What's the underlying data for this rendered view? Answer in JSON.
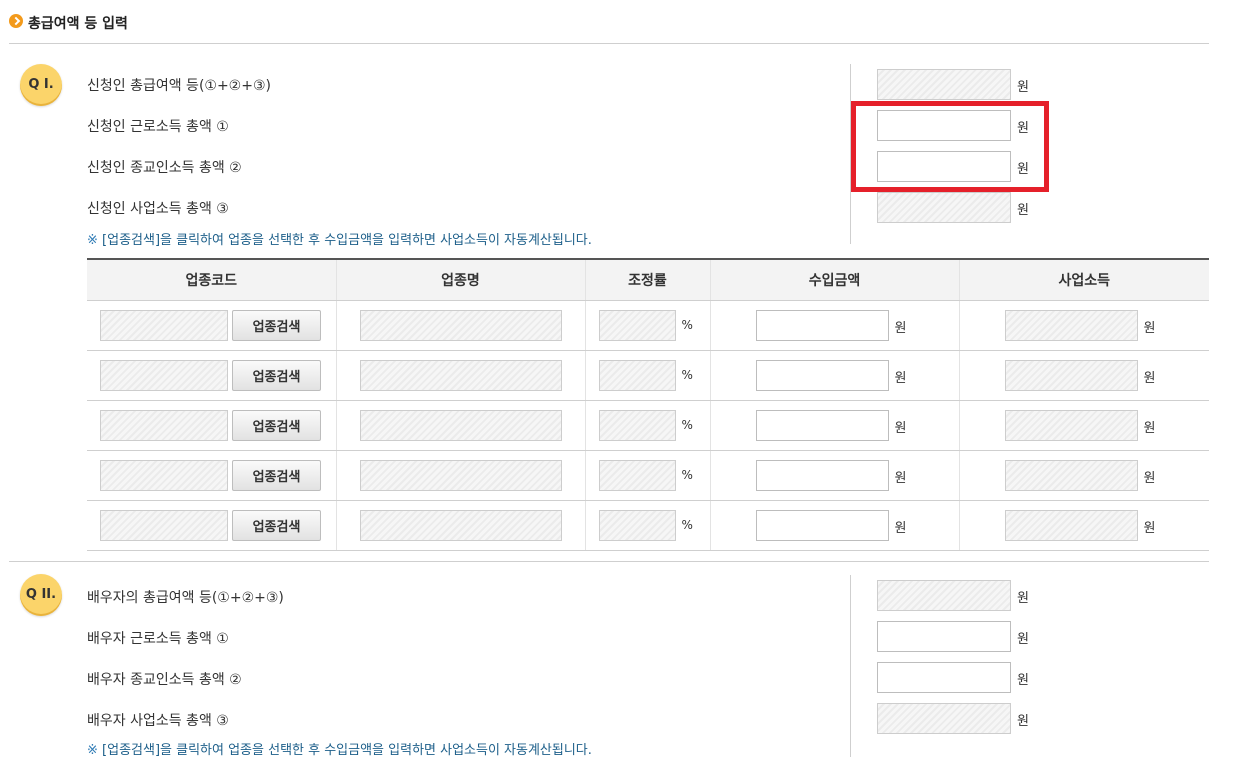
{
  "page": {
    "title": "총급여액 등 입력"
  },
  "q1": {
    "badge": "Q I.",
    "rows": [
      {
        "label": "신청인 총급여액 등(①+②+③)",
        "unit": "원",
        "readonly": true
      },
      {
        "label": "신청인 근로소득 총액 ①",
        "unit": "원",
        "readonly": false
      },
      {
        "label": "신청인 종교인소득 총액 ②",
        "unit": "원",
        "readonly": false
      },
      {
        "label": "신청인 사업소득 총액 ③",
        "unit": "원",
        "readonly": true
      }
    ],
    "note_mark": "※",
    "note": "[업종검색]을 클릭하여 업종을 선택한 후 수입금액을 입력하면 사업소득이 자동계산됩니다."
  },
  "table": {
    "headers": [
      "업종코드",
      "업종명",
      "조정률",
      "수입금액",
      "사업소득"
    ],
    "search_button": "업종검색",
    "percent": "%",
    "unit": "원",
    "rows": [
      1,
      2,
      3,
      4,
      5
    ]
  },
  "q2": {
    "badge": "Q II.",
    "rows": [
      {
        "label": "배우자의 총급여액 등(①+②+③)",
        "unit": "원",
        "readonly": true
      },
      {
        "label": "배우자 근로소득 총액 ①",
        "unit": "원",
        "readonly": false
      },
      {
        "label": "배우자 종교인소득 총액 ②",
        "unit": "원",
        "readonly": false
      },
      {
        "label": "배우자 사업소득 총액 ③",
        "unit": "원",
        "readonly": true
      }
    ],
    "note_mark": "※",
    "note": "[업종검색]을 클릭하여 업종을 선택한 후 수입금액을 입력하면 사업소득이 자동계산됩니다."
  },
  "colors": {
    "highlight": "#e5202a",
    "badge": "#fbd46a",
    "note": "#1d5f8a",
    "bullet": "#f39a1b"
  }
}
